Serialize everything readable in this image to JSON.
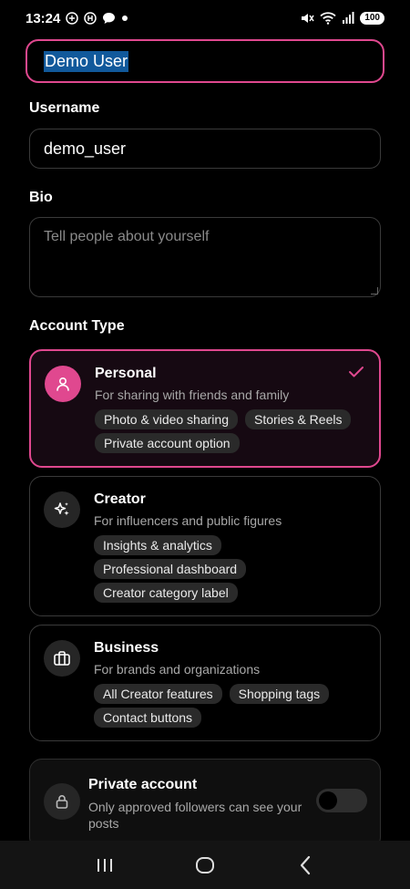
{
  "status_bar": {
    "time": "13:24",
    "battery": "100"
  },
  "form": {
    "name_value": "Demo User",
    "username_label": "Username",
    "username_value": "demo_user",
    "bio_label": "Bio",
    "bio_placeholder": "Tell people about yourself",
    "account_type_label": "Account Type"
  },
  "account_types": [
    {
      "title": "Personal",
      "description": "For sharing with friends and family",
      "selected": true,
      "icon": "user-icon",
      "tags": [
        "Photo & video sharing",
        "Stories & Reels",
        "Private account option"
      ]
    },
    {
      "title": "Creator",
      "description": "For influencers and public figures",
      "selected": false,
      "icon": "sparkles-icon",
      "tags": [
        "Insights & analytics",
        "Professional dashboard",
        "Creator category label"
      ]
    },
    {
      "title": "Business",
      "description": "For brands and organizations",
      "selected": false,
      "icon": "briefcase-icon",
      "tags": [
        "All Creator features",
        "Shopping tags",
        "Contact buttons"
      ]
    }
  ],
  "private_account": {
    "title": "Private account",
    "description": "Only approved followers can see your posts",
    "enabled": false,
    "icon": "lock-icon"
  },
  "colors": {
    "accent": "#e0488f",
    "background": "#000000",
    "selection": "#11599b"
  }
}
